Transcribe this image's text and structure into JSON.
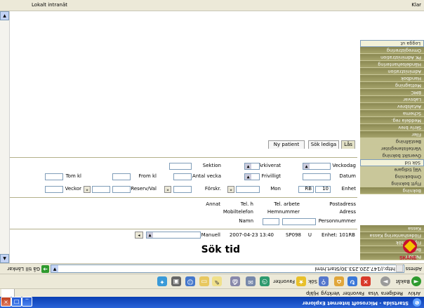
{
  "window": {
    "title": "Startsida - Microsoft Internet Explorer"
  },
  "menu": [
    "Arkiv",
    "Redigera",
    "Visa",
    "Favoriter",
    "Verktyg",
    "Hjälp"
  ],
  "toolbar": {
    "back": "Bakåt",
    "search": "Sök",
    "favorites": "Favoriter"
  },
  "address": {
    "label": "Adress",
    "url": "http://147.220.253.30/Start.html",
    "go": "Gå till",
    "links": "Länkar"
  },
  "status": {
    "left": "Klar",
    "right": "Lokalt intranät"
  },
  "sidebar": {
    "items": [
      "Bokning",
      "Flytt bokning",
      "Ombokning",
      "Välj tidigare",
      "Sök tid",
      "Översikt bokning",
      "Väntelisteregister",
      "Beställning",
      "Filer",
      "Skriv brev",
      "Meddela reg.",
      "Schema",
      "Avtalsbrev",
      "Labsvar",
      "BMC",
      "Mottagning",
      "Handbok",
      "Administration",
      "Händelsehantering",
      "PK Administration",
      "Omregistrering",
      "Logga ut"
    ],
    "top_items": [
      "Person",
      "Besök",
      "Flytt Besök",
      "Flödeshantering Kassa",
      "Kassa"
    ]
  },
  "logo": {
    "text": "SKÅNE"
  },
  "main": {
    "title": "Sök tid",
    "info_a": "Enhet: 101RB",
    "info_b": "U",
    "info_c": "SP098",
    "date": "2007-04-23 13:40",
    "dropdown_label": "Manuell",
    "personnummer_label": "Personnummer",
    "namn_label": "Namn",
    "row_adress": "Adress",
    "row_hemnummer": "Hemnummer",
    "row_mobil": "Mobiltelefon",
    "row_annat": "Annat",
    "row_postadress": "Postadress",
    "row_telarbete": "Tel. arbete",
    "row_tel_ett": "Tel. h",
    "row_anhorig": "Anhörig",
    "f_enhet": "Enhet",
    "f_enhet_val": "10",
    "f_enhet_code": "RB",
    "f_mon": "Mon",
    "f_fvisit": "Förskr.",
    "f_reserv": "Reserv/Val",
    "f_veckor": "Veckor",
    "f_datum": "Datum",
    "f_frivilligt": "Frivilligt",
    "f_antal": "Antal vecka",
    "f_from": "From kl",
    "f_tom": "Tom kl",
    "f_veckodag": "Veckodag",
    "f_arkiverad": "Arkiverat",
    "f_sektion": "Sektion",
    "tabs": [
      "Lås",
      "Sök lediga",
      "Ny patient"
    ]
  }
}
